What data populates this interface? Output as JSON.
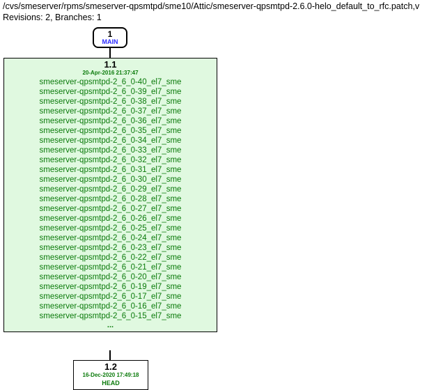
{
  "header": {
    "path": "/cvs/smeserver/rpms/smeserver-qpsmtpd/sme10/Attic/smeserver-qpsmtpd-2.6.0-helo_default_to_rfc.patch,v",
    "revisions_label": "Revisions: 2, Branches: 1"
  },
  "branch": {
    "number": "1",
    "name": "MAIN"
  },
  "rev1": {
    "number": "1.1",
    "date": "20-Apr-2016 21:37:47",
    "ellipsis": "...",
    "tags": [
      "smeserver-qpsmtpd-2_6_0-40_el7_sme",
      "smeserver-qpsmtpd-2_6_0-39_el7_sme",
      "smeserver-qpsmtpd-2_6_0-38_el7_sme",
      "smeserver-qpsmtpd-2_6_0-37_el7_sme",
      "smeserver-qpsmtpd-2_6_0-36_el7_sme",
      "smeserver-qpsmtpd-2_6_0-35_el7_sme",
      "smeserver-qpsmtpd-2_6_0-34_el7_sme",
      "smeserver-qpsmtpd-2_6_0-33_el7_sme",
      "smeserver-qpsmtpd-2_6_0-32_el7_sme",
      "smeserver-qpsmtpd-2_6_0-31_el7_sme",
      "smeserver-qpsmtpd-2_6_0-30_el7_sme",
      "smeserver-qpsmtpd-2_6_0-29_el7_sme",
      "smeserver-qpsmtpd-2_6_0-28_el7_sme",
      "smeserver-qpsmtpd-2_6_0-27_el7_sme",
      "smeserver-qpsmtpd-2_6_0-26_el7_sme",
      "smeserver-qpsmtpd-2_6_0-25_el7_sme",
      "smeserver-qpsmtpd-2_6_0-24_el7_sme",
      "smeserver-qpsmtpd-2_6_0-23_el7_sme",
      "smeserver-qpsmtpd-2_6_0-22_el7_sme",
      "smeserver-qpsmtpd-2_6_0-21_el7_sme",
      "smeserver-qpsmtpd-2_6_0-20_el7_sme",
      "smeserver-qpsmtpd-2_6_0-19_el7_sme",
      "smeserver-qpsmtpd-2_6_0-17_el7_sme",
      "smeserver-qpsmtpd-2_6_0-16_el7_sme",
      "smeserver-qpsmtpd-2_6_0-15_el7_sme"
    ]
  },
  "rev2": {
    "number": "1.2",
    "date": "16-Dec-2020 17:49:18",
    "head": "HEAD"
  }
}
